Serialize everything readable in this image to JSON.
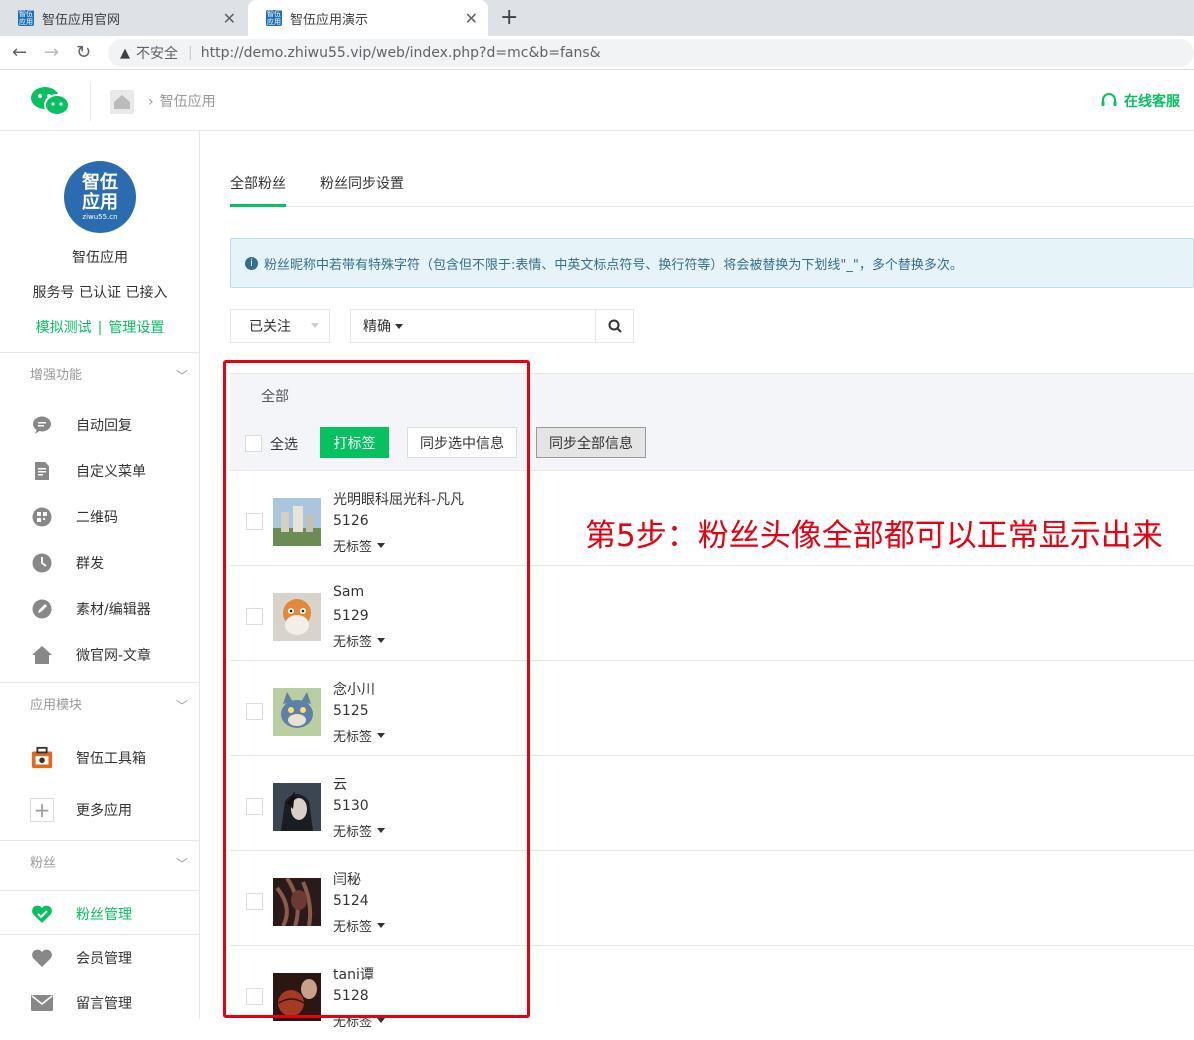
{
  "browser": {
    "tabs": [
      {
        "title": "智伍应用官网",
        "active": false
      },
      {
        "title": "智伍应用演示",
        "active": true
      }
    ],
    "insecure_label": "不安全",
    "url": "http://demo.zhiwu55.vip/web/index.php?d=mc&b=fans&"
  },
  "header": {
    "breadcrumb": "智伍应用",
    "service_label": "在线客服"
  },
  "account": {
    "logo_text_top": "智伍",
    "logo_text_bottom": "应用",
    "logo_sub": "ziwu55.cn",
    "name": "智伍应用",
    "status": "服务号 已认证 已接入",
    "link_test": "模拟测试",
    "link_manage": "管理设置"
  },
  "sidebar": {
    "section_enhance": "增强功能",
    "enhance_items": [
      {
        "label": "自动回复",
        "icon": "chat-bubble-icon"
      },
      {
        "label": "自定义菜单",
        "icon": "edit-doc-icon"
      },
      {
        "label": "二维码",
        "icon": "qrcode-icon"
      },
      {
        "label": "群发",
        "icon": "broadcast-clock-icon"
      },
      {
        "label": "素材/编辑器",
        "icon": "pencil-icon"
      },
      {
        "label": "微官网-文章",
        "icon": "home-icon"
      }
    ],
    "section_modules": "应用模块",
    "module_items": [
      {
        "label": "智伍工具箱",
        "icon": "toolbox-icon"
      },
      {
        "label": "更多应用",
        "icon": "plus-icon"
      }
    ],
    "section_fans": "粉丝",
    "fan_items": [
      {
        "label": "粉丝管理",
        "icon": "heart-check-icon",
        "active": true
      },
      {
        "label": "会员管理",
        "icon": "heart-icon",
        "active": false
      },
      {
        "label": "留言管理",
        "icon": "mail-icon",
        "active": false
      }
    ]
  },
  "main": {
    "tabs": [
      {
        "label": "全部粉丝",
        "active": true
      },
      {
        "label": "粉丝同步设置",
        "active": false
      }
    ],
    "alert": "粉丝昵称中若带有特殊字符（包含但不限于:表情、中英文标点符号、换行符等）将会被替换为下划线\"_\"，多个替换多次。",
    "filter_value": "已关注",
    "mode_label": "精确",
    "search_value": "",
    "list": {
      "group_label": "全部",
      "select_all": "全选",
      "tag_button": "打标签",
      "sync_selected": "同步选中信息",
      "sync_all": "同步全部信息"
    },
    "fans": [
      {
        "name": "光明眼科屈光科-凡凡",
        "id": "5126",
        "tag": "无标签",
        "avatar": "city-buildings"
      },
      {
        "name": "Sam",
        "id": "5129",
        "tag": "无标签",
        "avatar": "cartoon-orange-character"
      },
      {
        "name": "念小川",
        "id": "5125",
        "tag": "无标签",
        "avatar": "cartoon-cat"
      },
      {
        "name": "云",
        "id": "5130",
        "tag": "无标签",
        "avatar": "anime-portrait"
      },
      {
        "name": "闫秘",
        "id": "5124",
        "tag": "无标签",
        "avatar": "dark-abstract"
      },
      {
        "name": "tani谭",
        "id": "5128",
        "tag": "无标签",
        "avatar": "basketball-person"
      }
    ]
  },
  "annotation": "第5步：粉丝头像全部都可以正常显示出来",
  "colors": {
    "accent": "#07c160",
    "annotation": "#e60012",
    "alert_bg": "#e6f3f9"
  }
}
